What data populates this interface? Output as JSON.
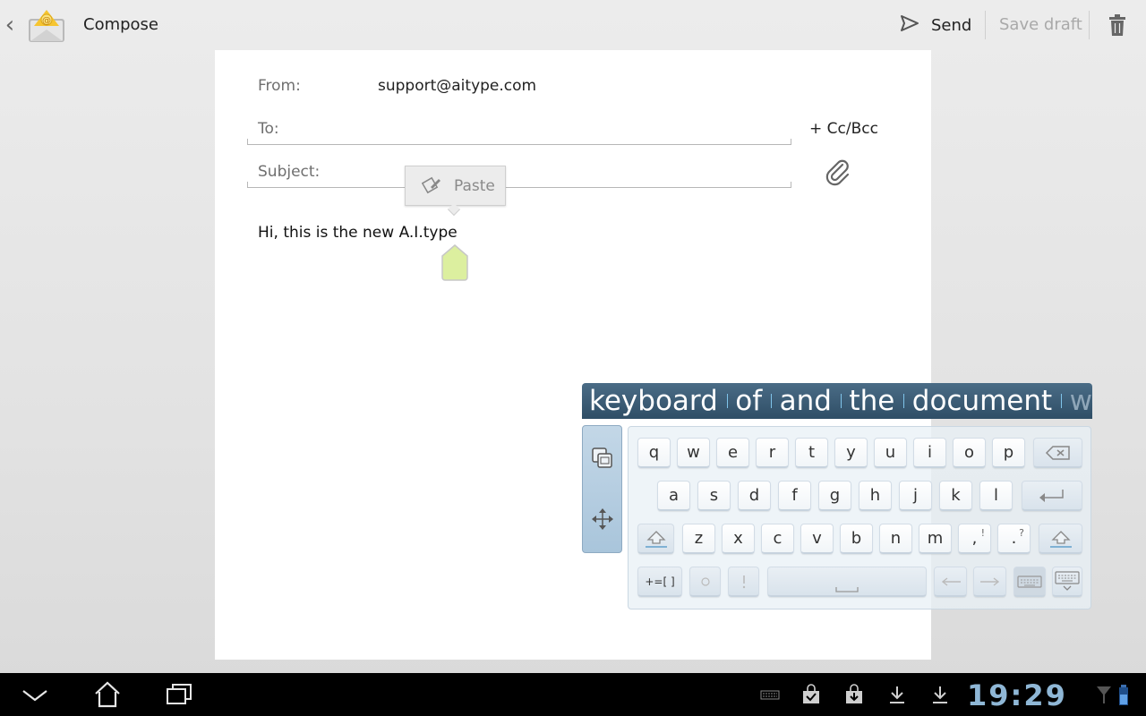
{
  "actionbar": {
    "title": "Compose",
    "send_label": "Send",
    "save_draft_label": "Save draft"
  },
  "compose": {
    "from_label": "From:",
    "from_value": "support@aitype.com",
    "to_label": "To:",
    "to_value": "",
    "cc_bcc_label": "+ Cc/Bcc",
    "subject_label": "Subject:",
    "subject_value": "",
    "body": "Hi, this is the new A.I.type"
  },
  "paste_popup": {
    "label": "Paste"
  },
  "keyboard": {
    "suggestions": [
      "keyboard",
      "of",
      "and",
      "the",
      "document",
      "w"
    ],
    "row1": [
      "q",
      "w",
      "e",
      "r",
      "t",
      "y",
      "u",
      "i",
      "o",
      "p"
    ],
    "row2": [
      "a",
      "s",
      "d",
      "f",
      "g",
      "h",
      "j",
      "k",
      "l"
    ],
    "row3": [
      "z",
      "x",
      "c",
      "v",
      "b",
      "n",
      "m"
    ],
    "comma_key": ",",
    "comma_alt": "!",
    "period_key": ".",
    "period_alt": "?",
    "symbols_key": "+=[ ]"
  },
  "systembar": {
    "clock": "19:29"
  },
  "colors": {
    "suggestion_bar": "#3b5a73",
    "clock": "#8fb7d6",
    "cursor_handle": "#dcef9f",
    "background": "#e4e4e4"
  },
  "icons": {
    "app": "email-envelope-icon",
    "send": "send-arrow-icon",
    "delete": "trash-icon",
    "attach": "paperclip-icon",
    "paste": "paste-pencil-icon",
    "back": "chevron-left-icon"
  }
}
